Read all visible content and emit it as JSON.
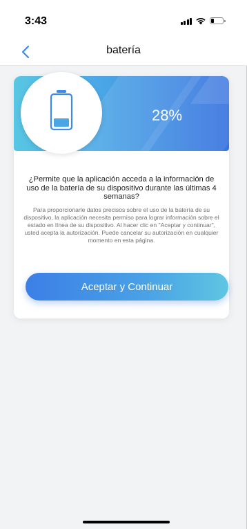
{
  "status_bar": {
    "time": "3:43",
    "icons": [
      "signal-icon",
      "wifi-icon",
      "battery-status-icon"
    ]
  },
  "nav": {
    "title": "batería",
    "back_icon": "chevron-left-icon"
  },
  "card": {
    "battery_level_fraction": 0.28,
    "battery_percent_label": "28%",
    "question": "¿Permite que la aplicación acceda a la información de uso de la batería de su dispositivo durante las últimas 4 semanas?",
    "description": "Para proporcionarle datos precisos sobre el uso de la batería de su dispositivo, la aplicación necesita permiso para lograr información sobre  el estado en línea de su dispositivo. Al hacer clic en \"Aceptar y continuar\", usted acepta la autorización. Puede cancelar su autorización en cualquier momento en esta página.",
    "accept_button": "Aceptar y Continuar"
  },
  "colors": {
    "accent": "#3a8bec",
    "banner_start": "#59c6e3",
    "banner_end": "#3a74e0"
  }
}
